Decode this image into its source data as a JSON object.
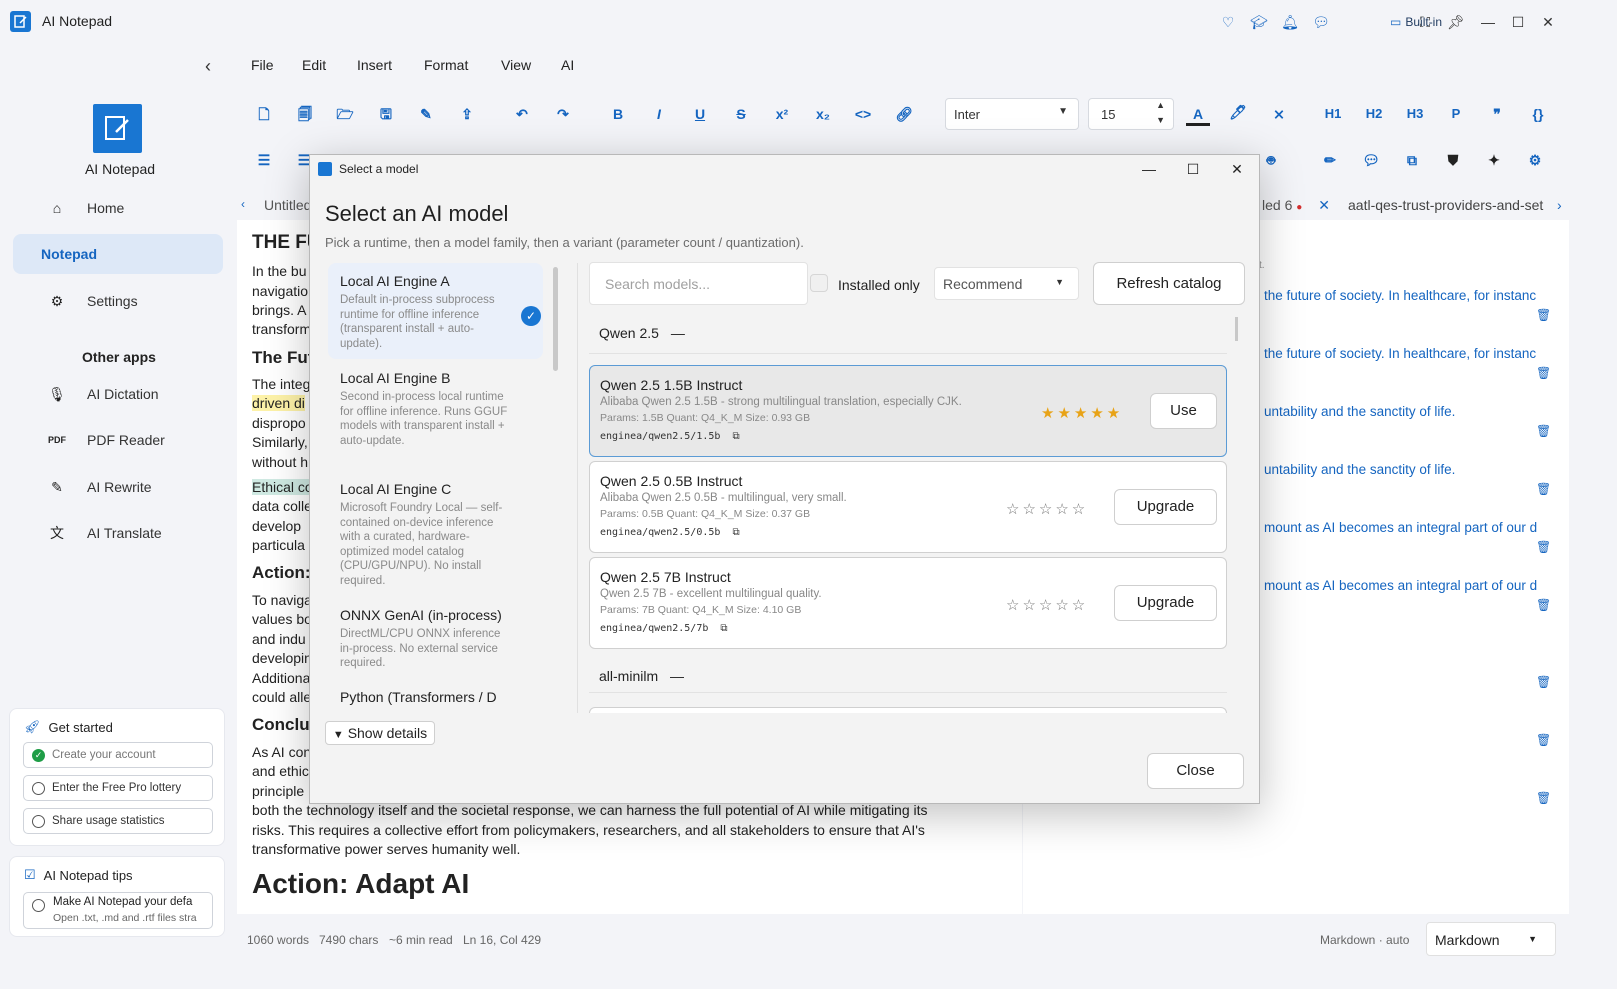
{
  "app": {
    "title": "AI Notepad",
    "builtin_label": "Built-in"
  },
  "sidebar": {
    "logo_text": "AI Notepad",
    "nav": [
      {
        "label": "Home",
        "icon": "home-icon"
      },
      {
        "label": "Notepad",
        "icon": ""
      },
      {
        "label": "Settings",
        "icon": "gear-icon"
      }
    ],
    "other_apps_label": "Other apps",
    "apps": [
      {
        "label": "AI Dictation",
        "icon": "microphone-icon"
      },
      {
        "label": "PDF Reader",
        "icon": "pdf-icon"
      },
      {
        "label": "AI Rewrite",
        "icon": "rewrite-icon"
      },
      {
        "label": "AI Translate",
        "icon": "translate-icon"
      }
    ],
    "get_started": {
      "title": "Get started",
      "items": [
        "Create your account",
        "Enter the Free Pro lottery",
        "Share usage statistics"
      ]
    },
    "tips": {
      "title": "AI Notepad tips",
      "item_title": "Make AI Notepad your defa",
      "item_sub": "Open .txt, .md and .rtf files stra"
    }
  },
  "menu": [
    "File",
    "Edit",
    "Insert",
    "Format",
    "View",
    "AI"
  ],
  "toolbar": {
    "font": "Inter",
    "size": "15",
    "headings": [
      "H1",
      "H2",
      "H3",
      "P"
    ]
  },
  "tabs": {
    "left": "Untitled",
    "right_partial": "led 6",
    "right": "aatl-qes-trust-providers-and-set"
  },
  "editor": {
    "h_the": "THE FU",
    "lines1": [
      "In the bu",
      "navigatio",
      "brings. A",
      "transform"
    ],
    "h_future": "The Fut",
    "lines2": [
      "The integ",
      "driven di",
      "dispropo",
      "Similarly,",
      "without h"
    ],
    "lines3": [
      "Ethical co",
      "data colle",
      "develop",
      "particula"
    ],
    "h_action": "Action:",
    "lines4": [
      "To naviga",
      "values bo",
      "and indu",
      "developin",
      "Additiona",
      "could alle"
    ],
    "h_conclusion": "Conclus",
    "lines5": [
      "As AI con",
      "and ethic",
      "principle"
    ],
    "full_line1": "both the technology itself and the societal response, we can harness the full potential of AI while mitigating its",
    "full_line2": "risks. This requires a collective effort from policymakers, researchers, and all stakeholders to ensure that AI's",
    "full_line3": "transformative power serves humanity well.",
    "h_adapt": "Action: Adapt AI"
  },
  "right_panel": {
    "lines": [
      "the future of society. In healthcare, for instanc",
      "the future of society. In healthcare, for instanc",
      "untability and the sanctity of life.",
      "untability and the sanctity of life.",
      "mount as AI becomes an integral part of our d",
      "mount as AI becomes an integral part of our d"
    ],
    "top_stub": "t."
  },
  "status": {
    "words": "1060 words",
    "chars": "7490 chars",
    "read": "~6 min read",
    "pos": "Ln 16, Col 429",
    "mode_hint": "Markdown · auto",
    "mode": "Markdown"
  },
  "dialog": {
    "window_title": "Select a model",
    "heading": "Select an AI model",
    "subtitle": "Pick a runtime, then a model family, then a variant (parameter count / quantization).",
    "runtimes": [
      {
        "name": "Local AI Engine A",
        "desc": "Default in-process subprocess runtime for offline inference (transparent install + auto-update)."
      },
      {
        "name": "Local AI Engine B",
        "desc": "Second in-process local runtime for offline inference. Runs GGUF models with transparent install + auto-update."
      },
      {
        "name": "Local AI Engine C",
        "desc": "Microsoft Foundry Local — self-contained on-device inference with a curated, hardware-optimized model catalog (CPU/GPU/NPU). No install required."
      },
      {
        "name": "ONNX GenAI (in-process)",
        "desc": "DirectML/CPU ONNX inference in-process. No external service required."
      },
      {
        "name": "Python (Transformers / D",
        "desc": ""
      }
    ],
    "search_placeholder": "Search models...",
    "installed_only": "Installed only",
    "sort": "Recommend",
    "refresh": "Refresh catalog",
    "families": [
      "Qwen 2.5",
      "all-minilm"
    ],
    "models": [
      {
        "name": "Qwen 2.5 1.5B Instruct",
        "desc": "Alibaba Qwen 2.5 1.5B - strong multilingual translation, especially CJK.",
        "meta": "Params: 1.5B     Quant: Q4_K_M     Size: 0.93 GB",
        "id": "enginea/qwen2.5/1.5b",
        "rating": 5,
        "action": "Use"
      },
      {
        "name": "Qwen 2.5 0.5B Instruct",
        "desc": "Alibaba Qwen 2.5 0.5B - multilingual, very small.",
        "meta": "Params: 0.5B     Quant: Q4_K_M     Size: 0.37 GB",
        "id": "enginea/qwen2.5/0.5b",
        "rating": 0,
        "action": "Upgrade"
      },
      {
        "name": "Qwen 2.5 7B Instruct",
        "desc": "Qwen 2.5 7B - excellent multilingual quality.",
        "meta": "Params: 7B     Quant: Q4_K_M     Size: 4.10 GB",
        "id": "enginea/qwen2.5/7b",
        "rating": 0,
        "action": "Upgrade"
      }
    ],
    "show_details": "Show details",
    "close": "Close"
  },
  "colors": {
    "accent": "#1976d2",
    "star": "#e8a317"
  }
}
